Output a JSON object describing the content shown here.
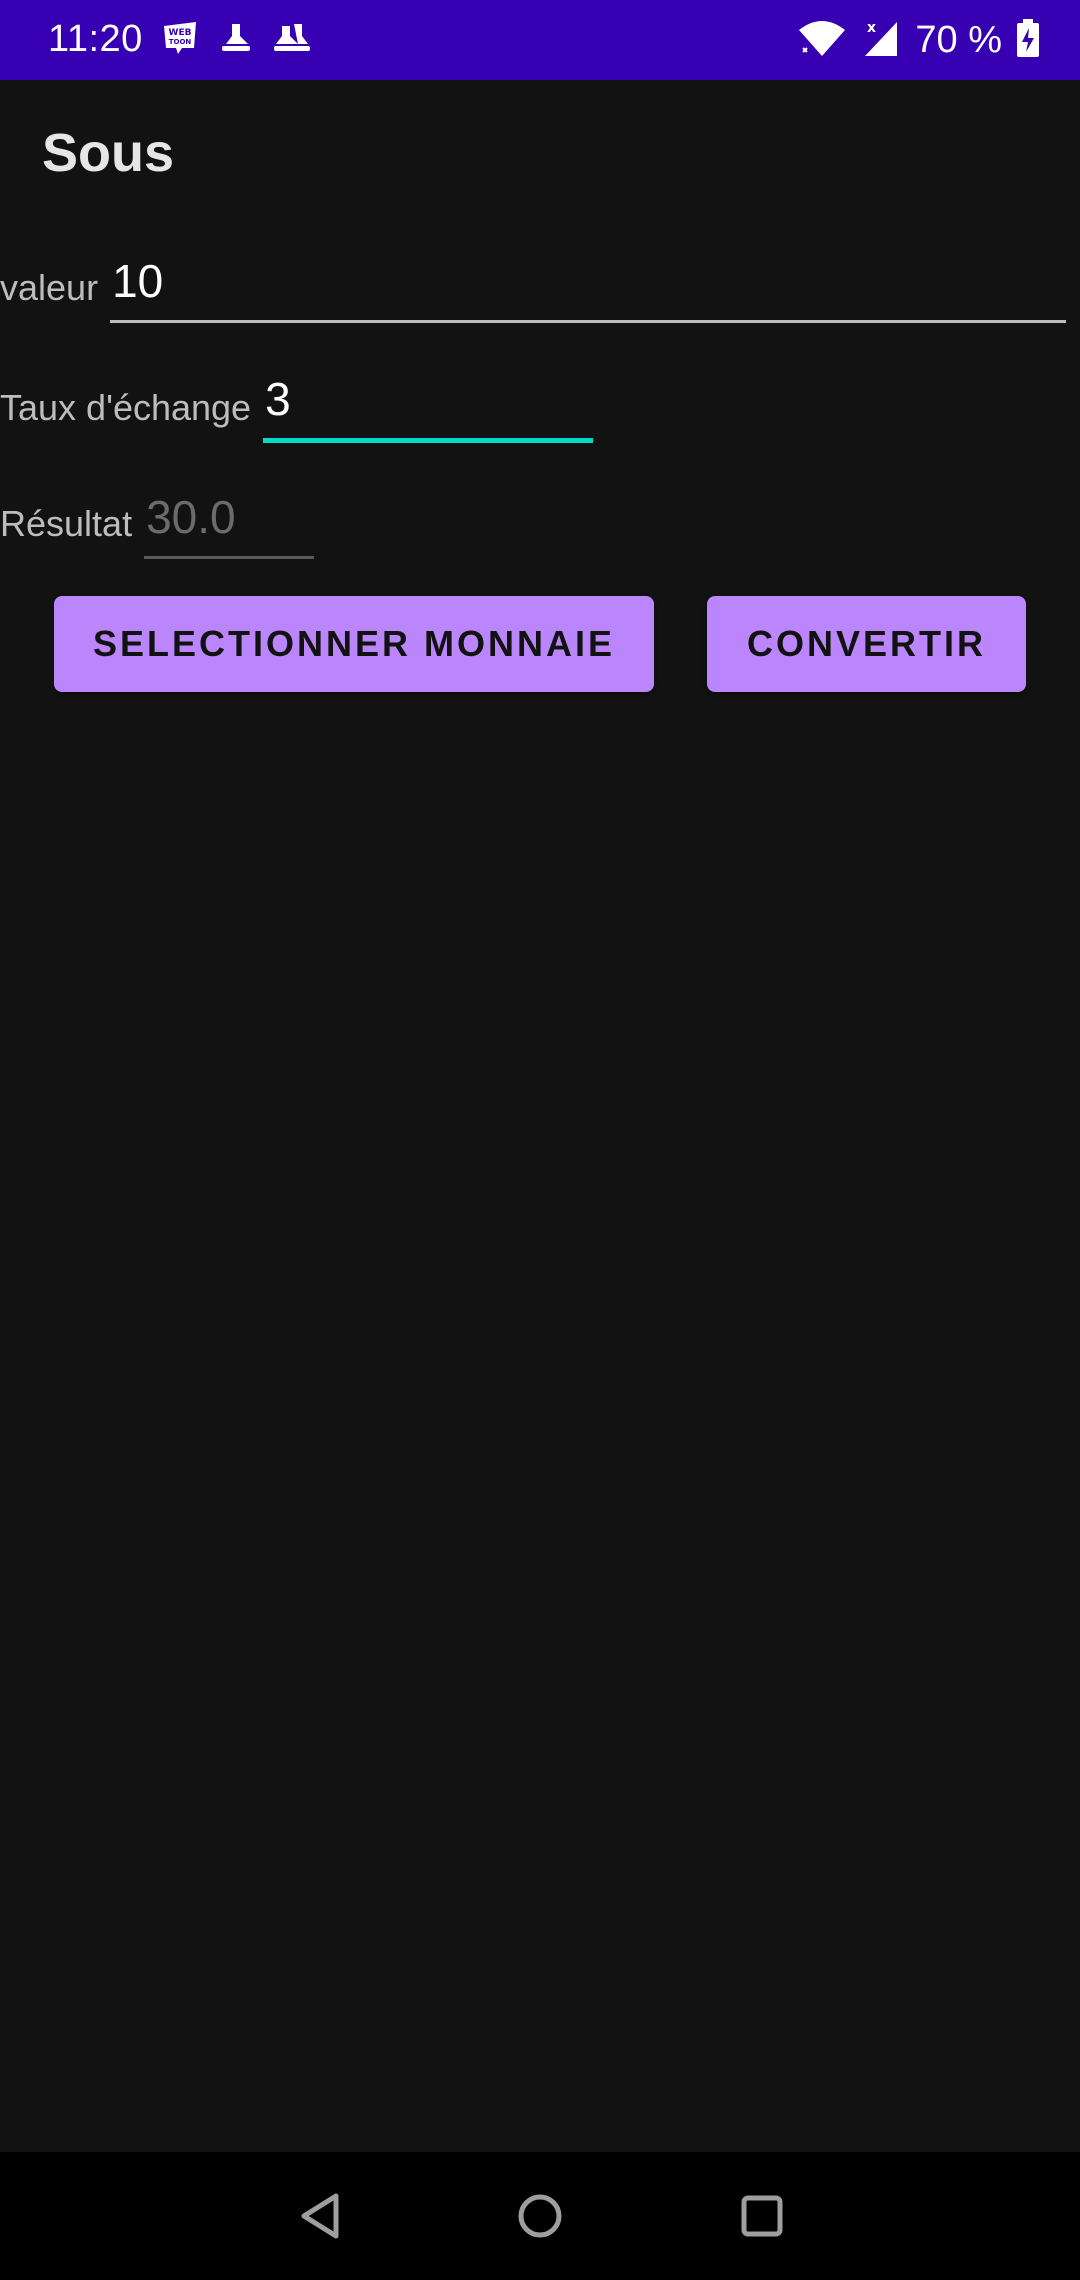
{
  "status_bar": {
    "time": "11:20",
    "battery_percent": "70 %",
    "notification_icons": [
      "webtoon-icon",
      "app-notification-icon",
      "app-notification-icon-2"
    ],
    "background": "#3700B3"
  },
  "app_bar": {
    "title": "Sous"
  },
  "form": {
    "valeur": {
      "label": "valeur",
      "value": "10"
    },
    "taux": {
      "label": "Taux d'échange",
      "value": "3"
    },
    "resultat": {
      "label": "Résultat",
      "value": "30.0"
    }
  },
  "buttons": {
    "select_currency": "SELECTIONNER MONNAIE",
    "convert": "CONVERTIR"
  },
  "theme": {
    "background": "#121212",
    "button": "#BB86FC",
    "focus_accent": "#03DAC5"
  },
  "nav_bar": {
    "icons": [
      "back-icon",
      "home-icon",
      "recents-icon"
    ]
  }
}
